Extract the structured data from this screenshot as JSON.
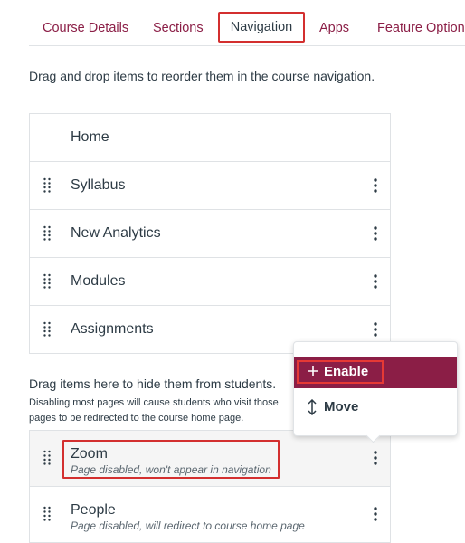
{
  "tabs": [
    {
      "label": "Course Details"
    },
    {
      "label": "Sections"
    },
    {
      "label": "Navigation"
    },
    {
      "label": "Apps"
    },
    {
      "label": "Feature Options"
    }
  ],
  "intro_text": "Drag and drop items to reorder them in the course navigation.",
  "enabled_items": [
    {
      "label": "Home"
    },
    {
      "label": "Syllabus"
    },
    {
      "label": "New Analytics"
    },
    {
      "label": "Modules"
    },
    {
      "label": "Assignments"
    }
  ],
  "hidden_section": {
    "title": "Drag items here to hide them from students.",
    "subtitle": "Disabling most pages will cause students who visit those pages to be redirected to the course home page."
  },
  "disabled_items": [
    {
      "label": "Zoom",
      "note": "Page disabled, won't appear in navigation"
    },
    {
      "label": "People",
      "note": "Page disabled, will redirect to course home page"
    }
  ],
  "menu": {
    "enable_label": "Enable",
    "move_label": "Move"
  },
  "icons": {
    "handle": "drag-handle-icon",
    "kebab": "more-options-icon",
    "plus": "plus-icon",
    "move": "move-arrows-icon"
  },
  "colors": {
    "accent": "#8b1e46",
    "highlight": "#d32f2f"
  }
}
